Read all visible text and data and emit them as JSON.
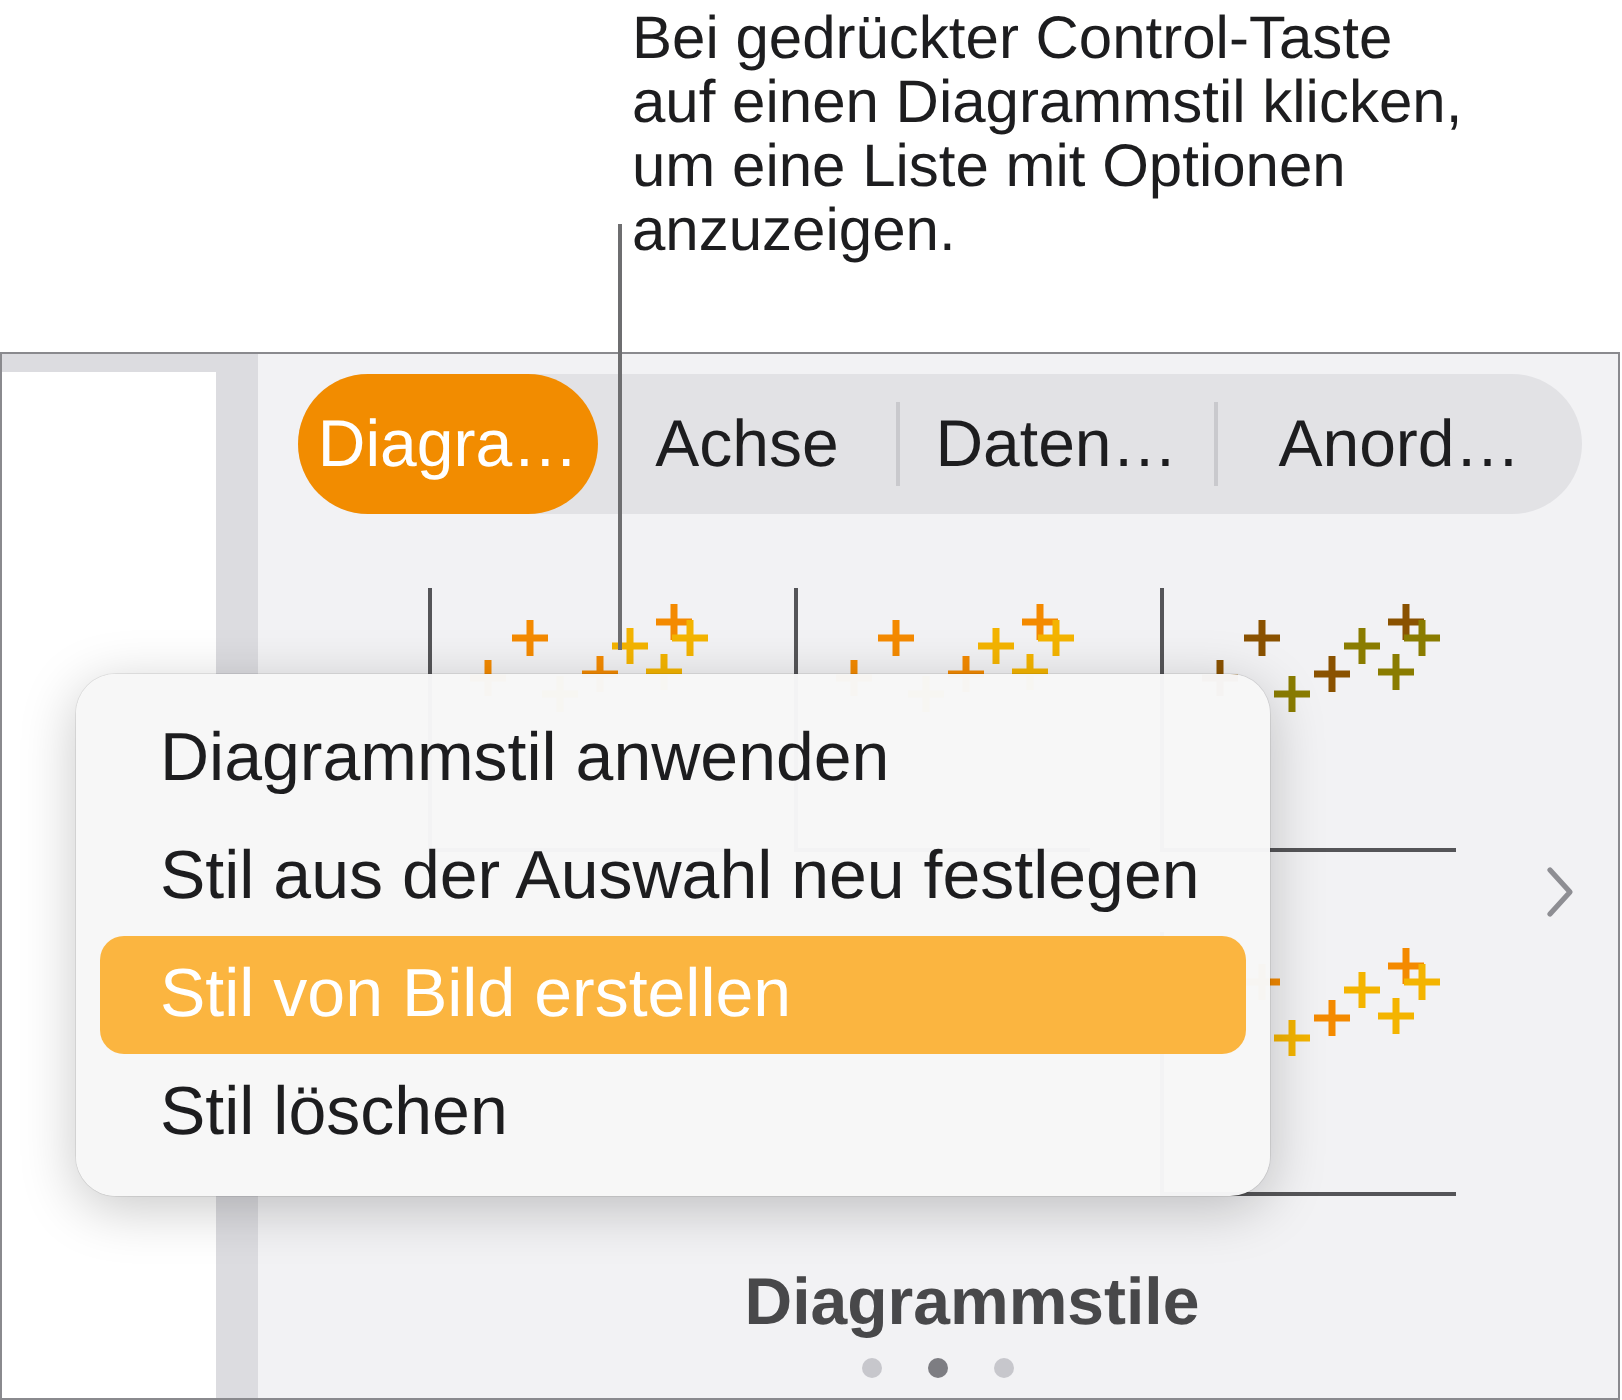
{
  "callout": {
    "text": "Bei gedrückter Control-Taste auf einen Diagrammstil klicken, um eine Liste mit Optionen anzuzeigen."
  },
  "tabs": [
    {
      "label": "Diagra…",
      "selected": true
    },
    {
      "label": "Achse",
      "selected": false
    },
    {
      "label": "Daten…",
      "selected": false
    },
    {
      "label": "Anord…",
      "selected": false
    }
  ],
  "chart_styles": {
    "thumbnails": [
      {
        "color": "#f48a00"
      },
      {
        "color": "#f48a00"
      },
      {
        "color": "#8a5200"
      },
      {
        "color": "#f48a00"
      }
    ],
    "title": "Diagrammstile",
    "pages": [
      {
        "selected": false
      },
      {
        "selected": true
      },
      {
        "selected": false
      }
    ]
  },
  "context_menu": {
    "items": [
      {
        "label": "Diagrammstil anwenden",
        "selected": false
      },
      {
        "label": "Stil aus der Auswahl neu festlegen",
        "selected": false
      },
      {
        "label": "Stil von Bild erstellen",
        "selected": true
      },
      {
        "label": "Stil löschen",
        "selected": false
      }
    ]
  }
}
